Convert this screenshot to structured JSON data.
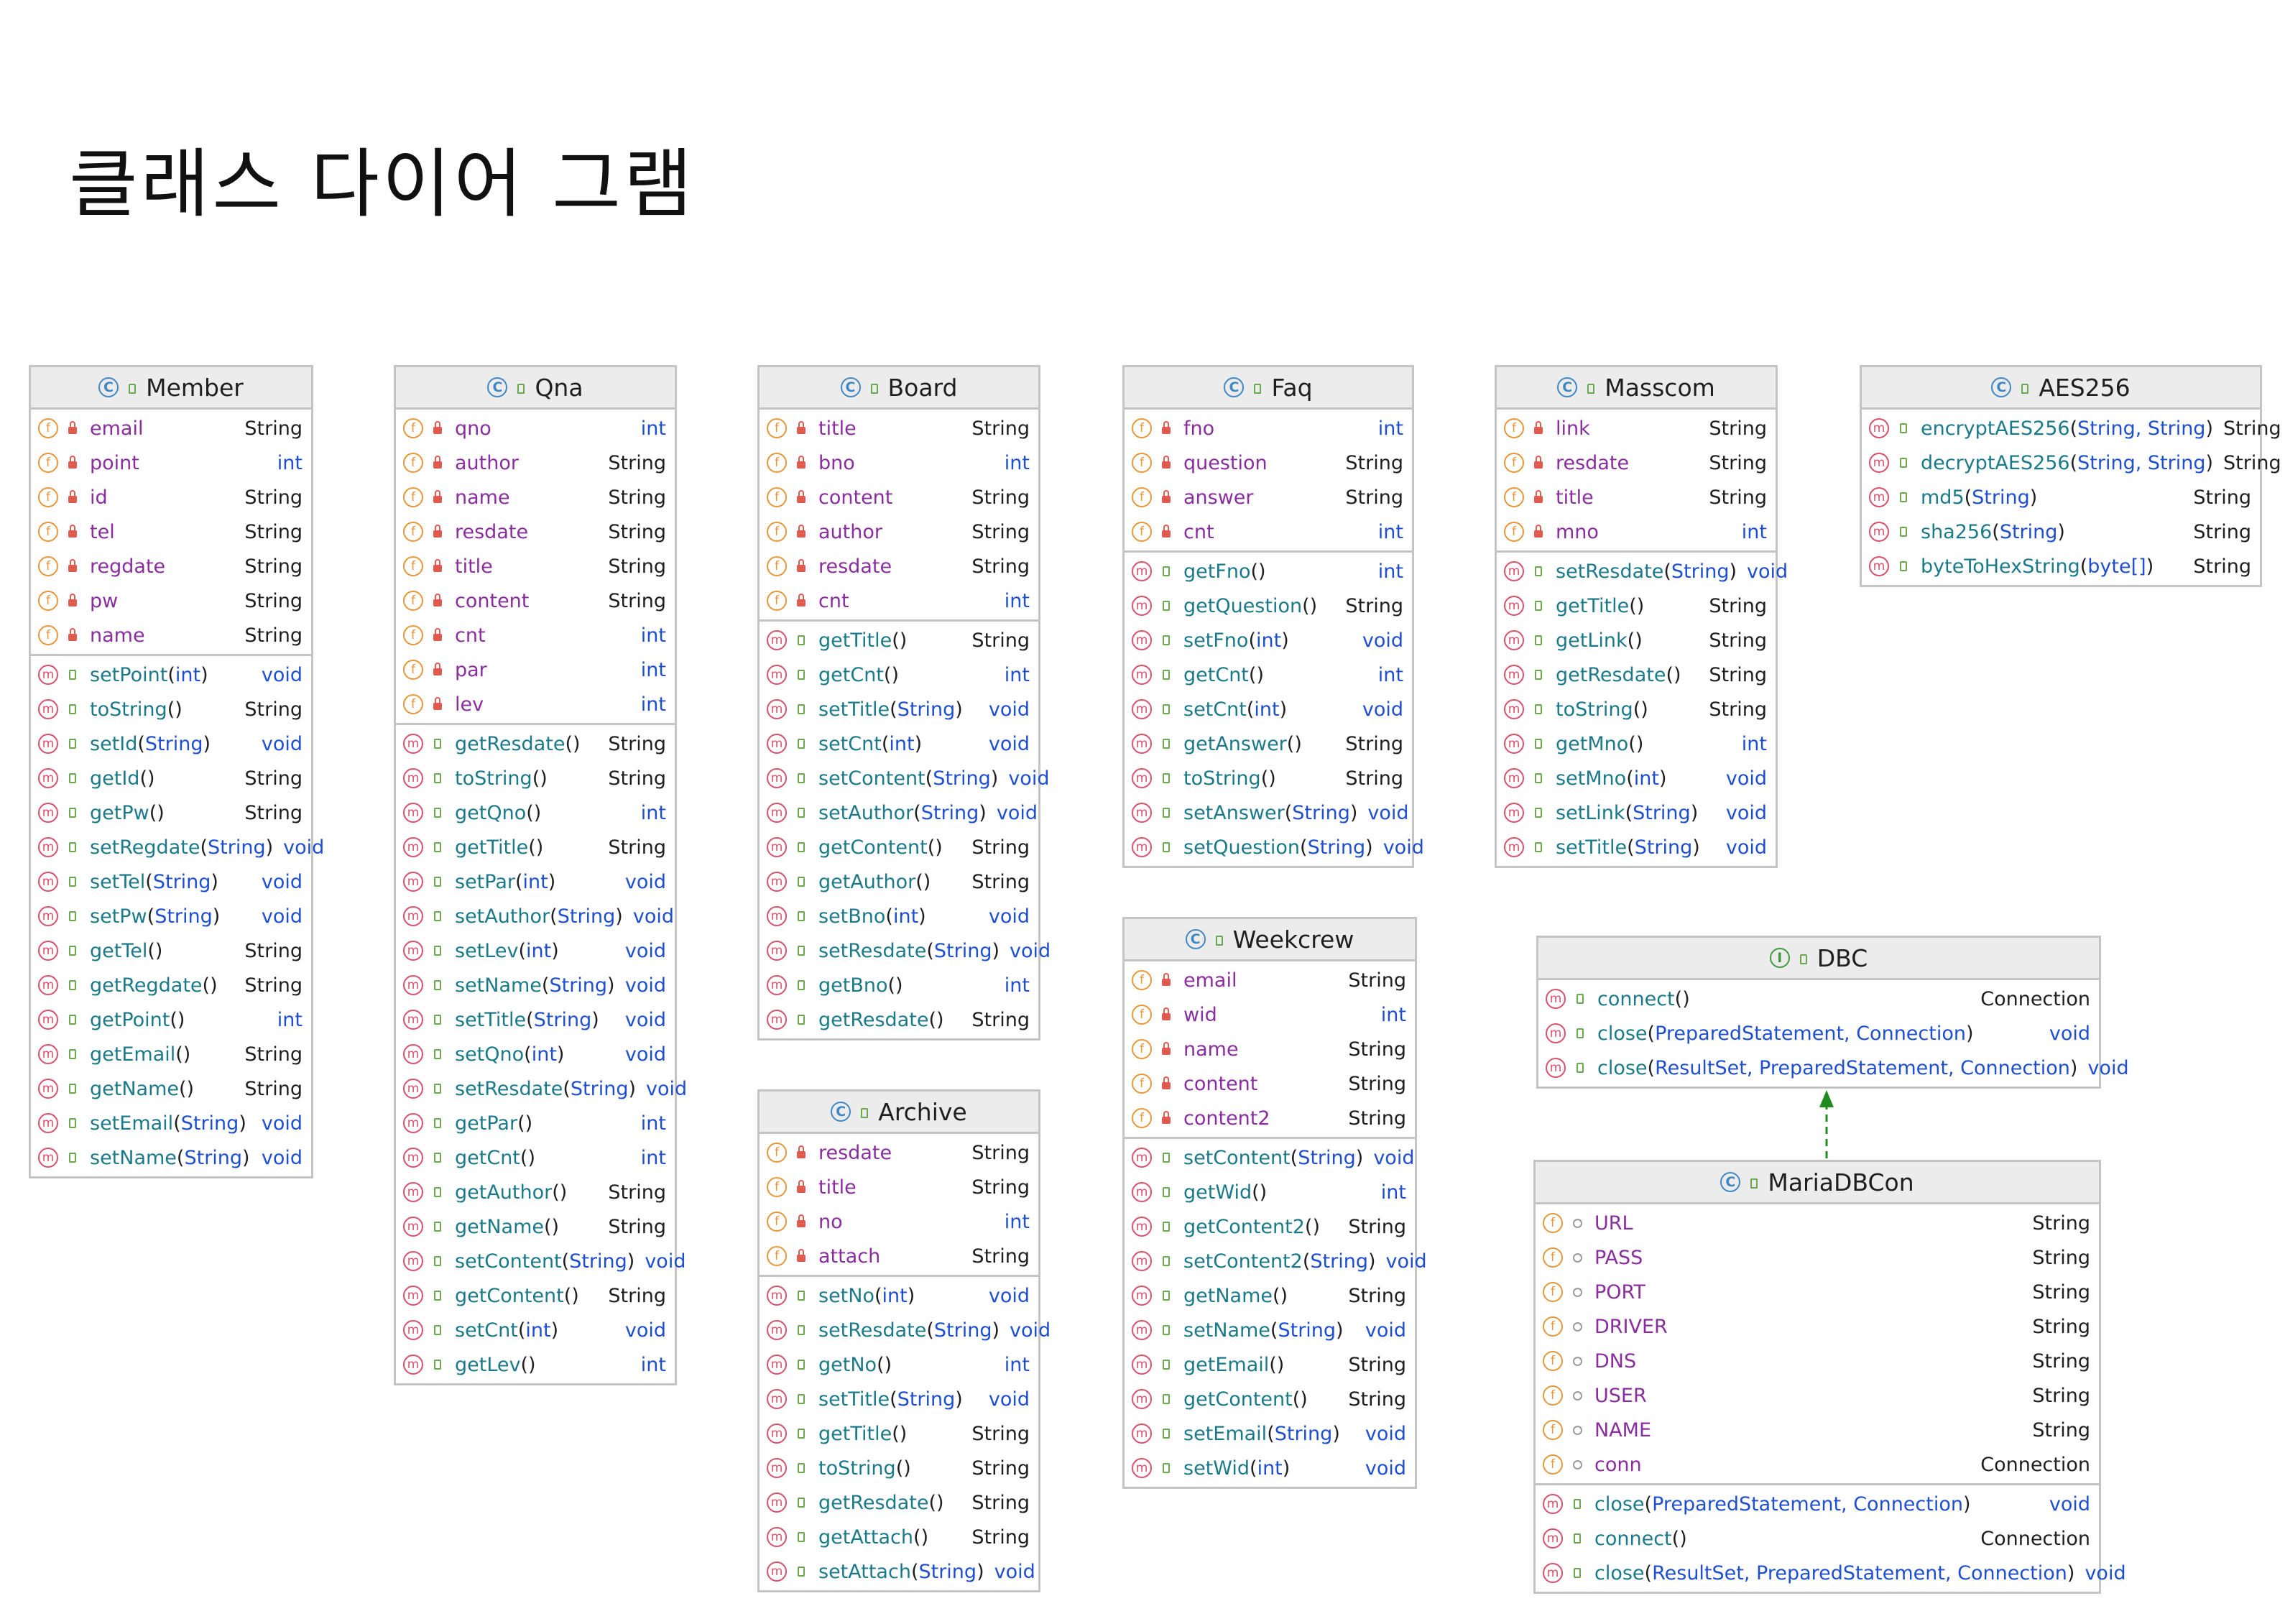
{
  "title": "클래스 다이어 그램",
  "diagram": {
    "classes": [
      {
        "id": "Member",
        "kind": "class",
        "name": "Member",
        "fields": [
          {
            "name": "email",
            "type": "String",
            "vis": "private"
          },
          {
            "name": "point",
            "type": "int",
            "vis": "private"
          },
          {
            "name": "id",
            "type": "String",
            "vis": "private"
          },
          {
            "name": "tel",
            "type": "String",
            "vis": "private"
          },
          {
            "name": "regdate",
            "type": "String",
            "vis": "private"
          },
          {
            "name": "pw",
            "type": "String",
            "vis": "private"
          },
          {
            "name": "name",
            "type": "String",
            "vis": "private"
          }
        ],
        "methods": [
          {
            "name": "setPoint",
            "params": "int",
            "ret": "void"
          },
          {
            "name": "toString",
            "params": "",
            "ret": "String"
          },
          {
            "name": "setId",
            "params": "String",
            "ret": "void"
          },
          {
            "name": "getId",
            "params": "",
            "ret": "String"
          },
          {
            "name": "getPw",
            "params": "",
            "ret": "String"
          },
          {
            "name": "setRegdate",
            "params": "String",
            "ret": "void"
          },
          {
            "name": "setTel",
            "params": "String",
            "ret": "void"
          },
          {
            "name": "setPw",
            "params": "String",
            "ret": "void"
          },
          {
            "name": "getTel",
            "params": "",
            "ret": "String"
          },
          {
            "name": "getRegdate",
            "params": "",
            "ret": "String"
          },
          {
            "name": "getPoint",
            "params": "",
            "ret": "int"
          },
          {
            "name": "getEmail",
            "params": "",
            "ret": "String"
          },
          {
            "name": "getName",
            "params": "",
            "ret": "String"
          },
          {
            "name": "setEmail",
            "params": "String",
            "ret": "void"
          },
          {
            "name": "setName",
            "params": "String",
            "ret": "void"
          }
        ]
      },
      {
        "id": "Qna",
        "kind": "class",
        "name": "Qna",
        "fields": [
          {
            "name": "qno",
            "type": "int",
            "vis": "private"
          },
          {
            "name": "author",
            "type": "String",
            "vis": "private"
          },
          {
            "name": "name",
            "type": "String",
            "vis": "private"
          },
          {
            "name": "resdate",
            "type": "String",
            "vis": "private"
          },
          {
            "name": "title",
            "type": "String",
            "vis": "private"
          },
          {
            "name": "content",
            "type": "String",
            "vis": "private"
          },
          {
            "name": "cnt",
            "type": "int",
            "vis": "private"
          },
          {
            "name": "par",
            "type": "int",
            "vis": "private"
          },
          {
            "name": "lev",
            "type": "int",
            "vis": "private"
          }
        ],
        "methods": [
          {
            "name": "getResdate",
            "params": "",
            "ret": "String"
          },
          {
            "name": "toString",
            "params": "",
            "ret": "String"
          },
          {
            "name": "getQno",
            "params": "",
            "ret": "int"
          },
          {
            "name": "getTitle",
            "params": "",
            "ret": "String"
          },
          {
            "name": "setPar",
            "params": "int",
            "ret": "void"
          },
          {
            "name": "setAuthor",
            "params": "String",
            "ret": "void"
          },
          {
            "name": "setLev",
            "params": "int",
            "ret": "void"
          },
          {
            "name": "setName",
            "params": "String",
            "ret": "void"
          },
          {
            "name": "setTitle",
            "params": "String",
            "ret": "void"
          },
          {
            "name": "setQno",
            "params": "int",
            "ret": "void"
          },
          {
            "name": "setResdate",
            "params": "String",
            "ret": "void"
          },
          {
            "name": "getPar",
            "params": "",
            "ret": "int"
          },
          {
            "name": "getCnt",
            "params": "",
            "ret": "int"
          },
          {
            "name": "getAuthor",
            "params": "",
            "ret": "String"
          },
          {
            "name": "getName",
            "params": "",
            "ret": "String"
          },
          {
            "name": "setContent",
            "params": "String",
            "ret": "void"
          },
          {
            "name": "getContent",
            "params": "",
            "ret": "String"
          },
          {
            "name": "setCnt",
            "params": "int",
            "ret": "void"
          },
          {
            "name": "getLev",
            "params": "",
            "ret": "int"
          }
        ]
      },
      {
        "id": "Board",
        "kind": "class",
        "name": "Board",
        "fields": [
          {
            "name": "title",
            "type": "String",
            "vis": "private"
          },
          {
            "name": "bno",
            "type": "int",
            "vis": "private"
          },
          {
            "name": "content",
            "type": "String",
            "vis": "private"
          },
          {
            "name": "author",
            "type": "String",
            "vis": "private"
          },
          {
            "name": "resdate",
            "type": "String",
            "vis": "private"
          },
          {
            "name": "cnt",
            "type": "int",
            "vis": "private"
          }
        ],
        "methods": [
          {
            "name": "getTitle",
            "params": "",
            "ret": "String"
          },
          {
            "name": "getCnt",
            "params": "",
            "ret": "int"
          },
          {
            "name": "setTitle",
            "params": "String",
            "ret": "void"
          },
          {
            "name": "setCnt",
            "params": "int",
            "ret": "void"
          },
          {
            "name": "setContent",
            "params": "String",
            "ret": "void"
          },
          {
            "name": "setAuthor",
            "params": "String",
            "ret": "void"
          },
          {
            "name": "getContent",
            "params": "",
            "ret": "String"
          },
          {
            "name": "getAuthor",
            "params": "",
            "ret": "String"
          },
          {
            "name": "setBno",
            "params": "int",
            "ret": "void"
          },
          {
            "name": "setResdate",
            "params": "String",
            "ret": "void"
          },
          {
            "name": "getBno",
            "params": "",
            "ret": "int"
          },
          {
            "name": "getResdate",
            "params": "",
            "ret": "String"
          }
        ]
      },
      {
        "id": "Archive",
        "kind": "class",
        "name": "Archive",
        "fields": [
          {
            "name": "resdate",
            "type": "String",
            "vis": "private"
          },
          {
            "name": "title",
            "type": "String",
            "vis": "private"
          },
          {
            "name": "no",
            "type": "int",
            "vis": "private"
          },
          {
            "name": "attach",
            "type": "String",
            "vis": "private"
          }
        ],
        "methods": [
          {
            "name": "setNo",
            "params": "int",
            "ret": "void"
          },
          {
            "name": "setResdate",
            "params": "String",
            "ret": "void"
          },
          {
            "name": "getNo",
            "params": "",
            "ret": "int"
          },
          {
            "name": "setTitle",
            "params": "String",
            "ret": "void"
          },
          {
            "name": "getTitle",
            "params": "",
            "ret": "String"
          },
          {
            "name": "toString",
            "params": "",
            "ret": "String"
          },
          {
            "name": "getResdate",
            "params": "",
            "ret": "String"
          },
          {
            "name": "getAttach",
            "params": "",
            "ret": "String"
          },
          {
            "name": "setAttach",
            "params": "String",
            "ret": "void"
          }
        ]
      },
      {
        "id": "Faq",
        "kind": "class",
        "name": "Faq",
        "fields": [
          {
            "name": "fno",
            "type": "int",
            "vis": "private"
          },
          {
            "name": "question",
            "type": "String",
            "vis": "private"
          },
          {
            "name": "answer",
            "type": "String",
            "vis": "private"
          },
          {
            "name": "cnt",
            "type": "int",
            "vis": "private"
          }
        ],
        "methods": [
          {
            "name": "getFno",
            "params": "",
            "ret": "int"
          },
          {
            "name": "getQuestion",
            "params": "",
            "ret": "String"
          },
          {
            "name": "setFno",
            "params": "int",
            "ret": "void"
          },
          {
            "name": "getCnt",
            "params": "",
            "ret": "int"
          },
          {
            "name": "setCnt",
            "params": "int",
            "ret": "void"
          },
          {
            "name": "getAnswer",
            "params": "",
            "ret": "String"
          },
          {
            "name": "toString",
            "params": "",
            "ret": "String"
          },
          {
            "name": "setAnswer",
            "params": "String",
            "ret": "void"
          },
          {
            "name": "setQuestion",
            "params": "String",
            "ret": "void"
          }
        ]
      },
      {
        "id": "Weekcrew",
        "kind": "class",
        "name": "Weekcrew",
        "fields": [
          {
            "name": "email",
            "type": "String",
            "vis": "private"
          },
          {
            "name": "wid",
            "type": "int",
            "vis": "private"
          },
          {
            "name": "name",
            "type": "String",
            "vis": "private"
          },
          {
            "name": "content",
            "type": "String",
            "vis": "private"
          },
          {
            "name": "content2",
            "type": "String",
            "vis": "private"
          }
        ],
        "methods": [
          {
            "name": "setContent",
            "params": "String",
            "ret": "void"
          },
          {
            "name": "getWid",
            "params": "",
            "ret": "int"
          },
          {
            "name": "getContent2",
            "params": "",
            "ret": "String"
          },
          {
            "name": "setContent2",
            "params": "String",
            "ret": "void"
          },
          {
            "name": "getName",
            "params": "",
            "ret": "String"
          },
          {
            "name": "setName",
            "params": "String",
            "ret": "void"
          },
          {
            "name": "getEmail",
            "params": "",
            "ret": "String"
          },
          {
            "name": "getContent",
            "params": "",
            "ret": "String"
          },
          {
            "name": "setEmail",
            "params": "String",
            "ret": "void"
          },
          {
            "name": "setWid",
            "params": "int",
            "ret": "void"
          }
        ]
      },
      {
        "id": "Masscom",
        "kind": "class",
        "name": "Masscom",
        "fields": [
          {
            "name": "link",
            "type": "String",
            "vis": "private"
          },
          {
            "name": "resdate",
            "type": "String",
            "vis": "private"
          },
          {
            "name": "title",
            "type": "String",
            "vis": "private"
          },
          {
            "name": "mno",
            "type": "int",
            "vis": "private"
          }
        ],
        "methods": [
          {
            "name": "setResdate",
            "params": "String",
            "ret": "void"
          },
          {
            "name": "getTitle",
            "params": "",
            "ret": "String"
          },
          {
            "name": "getLink",
            "params": "",
            "ret": "String"
          },
          {
            "name": "getResdate",
            "params": "",
            "ret": "String"
          },
          {
            "name": "toString",
            "params": "",
            "ret": "String"
          },
          {
            "name": "getMno",
            "params": "",
            "ret": "int"
          },
          {
            "name": "setMno",
            "params": "int",
            "ret": "void"
          },
          {
            "name": "setLink",
            "params": "String",
            "ret": "void"
          },
          {
            "name": "setTitle",
            "params": "String",
            "ret": "void"
          }
        ]
      },
      {
        "id": "AES256",
        "kind": "class",
        "name": "AES256",
        "fields": [],
        "methods": [
          {
            "name": "encryptAES256",
            "params": "String, String",
            "ret": "String"
          },
          {
            "name": "decryptAES256",
            "params": "String, String",
            "ret": "String"
          },
          {
            "name": "md5",
            "params": "String",
            "ret": "String"
          },
          {
            "name": "sha256",
            "params": "String",
            "ret": "String"
          },
          {
            "name": "byteToHexString",
            "params": "byte[]",
            "ret": "String"
          }
        ]
      },
      {
        "id": "DBC",
        "kind": "interface",
        "name": "DBC",
        "fields": [],
        "methods": [
          {
            "name": "connect",
            "params": "",
            "ret": "Connection"
          },
          {
            "name": "close",
            "params": "PreparedStatement, Connection",
            "ret": "void"
          },
          {
            "name": "close",
            "params": "ResultSet, PreparedStatement, Connection",
            "ret": "void"
          }
        ]
      },
      {
        "id": "MariaDBCon",
        "kind": "class",
        "name": "MariaDBCon",
        "fields": [
          {
            "name": "URL",
            "type": "String",
            "vis": "package"
          },
          {
            "name": "PASS",
            "type": "String",
            "vis": "package"
          },
          {
            "name": "PORT",
            "type": "String",
            "vis": "package"
          },
          {
            "name": "DRIVER",
            "type": "String",
            "vis": "package"
          },
          {
            "name": "DNS",
            "type": "String",
            "vis": "package"
          },
          {
            "name": "USER",
            "type": "String",
            "vis": "package"
          },
          {
            "name": "NAME",
            "type": "String",
            "vis": "package"
          },
          {
            "name": "conn",
            "type": "Connection",
            "vis": "package"
          }
        ],
        "methods": [
          {
            "name": "close",
            "params": "PreparedStatement, Connection",
            "ret": "void"
          },
          {
            "name": "connect",
            "params": "",
            "ret": "Connection"
          },
          {
            "name": "close",
            "params": "ResultSet, PreparedStatement, Connection",
            "ret": "void"
          }
        ]
      }
    ],
    "relations": [
      {
        "from": "MariaDBCon",
        "to": "DBC",
        "type": "realization",
        "style": "dashed",
        "color": "#1e8c1e"
      }
    ],
    "icon_colors": {
      "field": "#e8963a",
      "method": "#d9506a",
      "class": "#3f88c5",
      "interface": "#3f9a3f"
    }
  }
}
